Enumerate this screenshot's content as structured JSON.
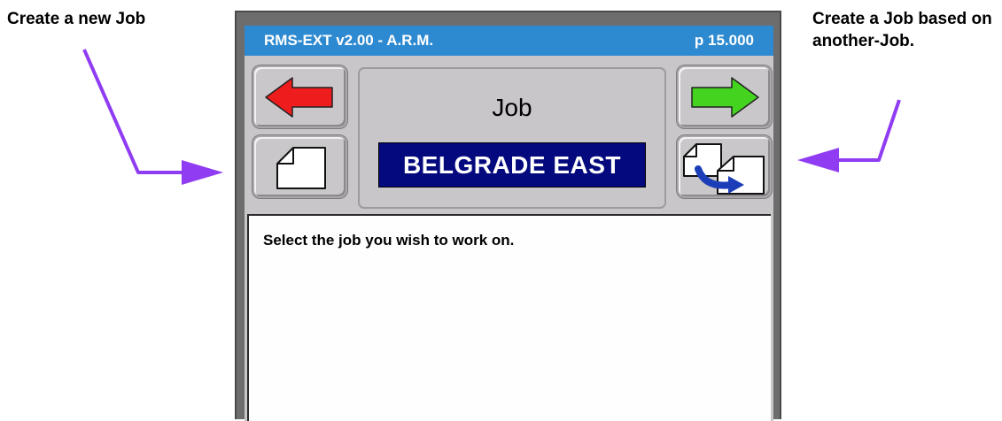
{
  "callouts": {
    "left": "Create a new Job",
    "right": "Create a Job based on another-Job."
  },
  "titlebar": {
    "title": "RMS-EXT v2.00 - A.R.M.",
    "page": "p 15.000"
  },
  "center": {
    "label": "Job",
    "selected_job": "BELGRADE EAST"
  },
  "message": "Select the job you wish to work on.",
  "icons": {
    "back": "red-left-arrow-icon",
    "forward": "green-right-arrow-icon",
    "new": "new-document-icon",
    "copy": "copy-document-icon"
  },
  "colors": {
    "titlebar": "#2e8ad0",
    "job_background": "#040a7d",
    "back_arrow": "#ee1c1c",
    "forward_arrow": "#44d420",
    "callout_arrow": "#8f3cf3"
  }
}
